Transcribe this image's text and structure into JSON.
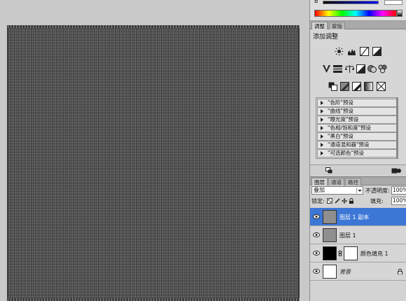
{
  "color_panel": {
    "channel_label": "B"
  },
  "adjustments": {
    "tabs": [
      "调整",
      "蒙版"
    ],
    "active_tab": 0,
    "title": "添加调整",
    "presets": [
      "\"色阶\"预设",
      "\"曲线\"预设",
      "\"曝光度\"预设",
      "\"色相/饱和度\"预设",
      "\"黑白\"预设",
      "\"通道混和器\"预设",
      "\"可选颜色\"预设"
    ]
  },
  "layers": {
    "tabs": [
      "图层",
      "通道",
      "路径"
    ],
    "active_tab": 0,
    "blend_mode": "叠加",
    "opacity_label": "不透明度:",
    "opacity_value": "100%",
    "lock_label": "锁定:",
    "fill_label": "填充:",
    "fill_value": "100%",
    "items": [
      {
        "name": "图层 1 副本",
        "thumb": "gray",
        "selected": true
      },
      {
        "name": "图层 1",
        "thumb": "gray",
        "selected": false
      },
      {
        "name": "颜色填充 1",
        "thumb": "fill",
        "selected": false
      },
      {
        "name": "背景",
        "thumb": "white",
        "selected": false,
        "locked": true
      }
    ]
  },
  "colors": {
    "selection": "#3d77d6",
    "canvas": "#4f4f4f"
  }
}
